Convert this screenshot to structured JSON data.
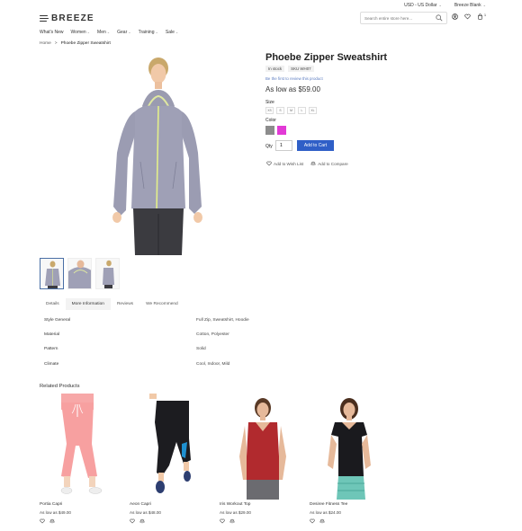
{
  "topbar": {
    "currency": "USD - US Dollar",
    "account": "Breeze Blank"
  },
  "header": {
    "logo_text": "BREEZE",
    "search_placeholder": "Search entire store here...",
    "cart_count": "1"
  },
  "nav": [
    {
      "label": "What's New",
      "has_caret": false
    },
    {
      "label": "Women",
      "has_caret": true
    },
    {
      "label": "Men",
      "has_caret": true
    },
    {
      "label": "Gear",
      "has_caret": true
    },
    {
      "label": "Training",
      "has_caret": true
    },
    {
      "label": "Sale",
      "has_caret": true
    }
  ],
  "breadcrumb": {
    "home": "Home",
    "separator": ">",
    "current": "Phoebe Zipper Sweatshirt"
  },
  "product": {
    "title": "Phoebe Zipper Sweatshirt",
    "stock": "In stock",
    "sku": "SKU WH07",
    "review_link": "Be the first to review this product",
    "price": "As low as $59.00",
    "size_label": "Size",
    "sizes": [
      "XS",
      "S",
      "M",
      "L",
      "XL"
    ],
    "color_label": "Color",
    "colors": [
      "#8c8c8c",
      "#e23ad6"
    ],
    "qty_label": "Qty",
    "qty_value": "1",
    "add_to_cart": "Add to Cart",
    "wishlist": "Add to Wish List",
    "compare": "Add to Compare"
  },
  "tabs": [
    "Details",
    "More Information",
    "Reviews",
    "We Recommend"
  ],
  "more_info": [
    {
      "key": "Style General",
      "value": "Full Zip, Sweatshirt, Hoodie"
    },
    {
      "key": "Material",
      "value": "Cotton, Polyester"
    },
    {
      "key": "Pattern",
      "value": "Solid"
    },
    {
      "key": "Climate",
      "value": "Cool, Indoor, Mild"
    }
  ],
  "related": {
    "title": "Related Products",
    "items": [
      {
        "name": "Portia Capri",
        "price": "As low as $49.00"
      },
      {
        "name": "Aeon Capri",
        "price": "As low as $48.00"
      },
      {
        "name": "Iris Workout Top",
        "price": "As low as $29.00"
      },
      {
        "name": "Desiree Fitness Tee",
        "price": "As low as $24.00"
      }
    ]
  }
}
